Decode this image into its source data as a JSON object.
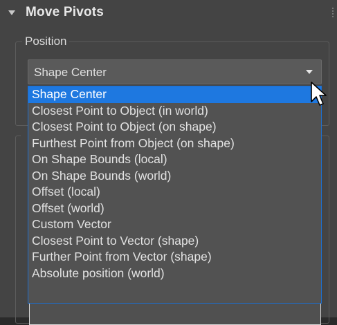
{
  "rollout": {
    "title": "Move Pivots",
    "collapse_icon": "triangle-down-icon",
    "grip_icon": "drag-grip-icon"
  },
  "position_group": {
    "label": "Position",
    "combo": {
      "selected_value": "Shape Center",
      "arrow_icon": "chevron-down-icon"
    },
    "options": [
      "Shape Center",
      "Closest Point to Object (in world)",
      "Closest Point to Object (on shape)",
      "Furthest Point from Object (on shape)",
      "On Shape Bounds (local)",
      "On Shape Bounds (world)",
      "Offset (local)",
      "Offset (world)",
      "Custom Vector",
      "Closest Point to Vector (shape)",
      "Further Point from Vector (shape)",
      "Absolute position (world)"
    ],
    "highlighted_option_index": 0
  },
  "colors": {
    "panel_bg": "#444444",
    "highlight": "#1e78e0",
    "dropdown_border": "#1c6fd0",
    "text": "#e2e2e2"
  },
  "cursor": {
    "icon": "mouse-pointer-icon"
  }
}
